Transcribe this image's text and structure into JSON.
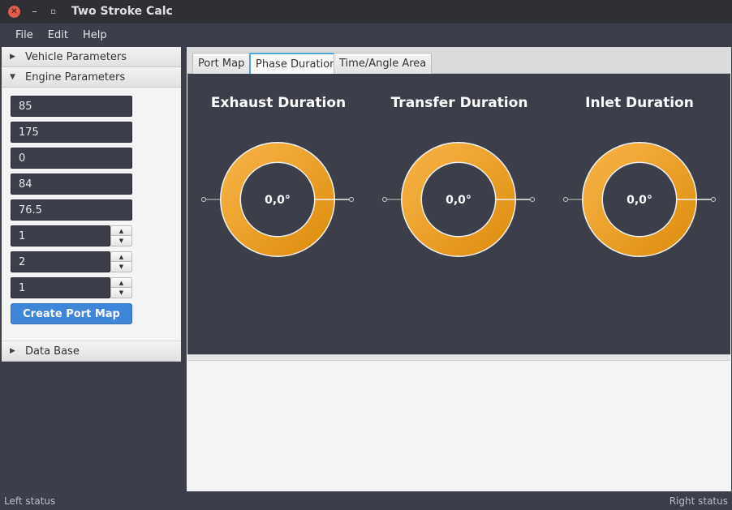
{
  "window": {
    "title": "Two Stroke Calc",
    "close_glyph": "✕",
    "minimize_glyph": "–",
    "maximize_glyph": "▫"
  },
  "menu": [
    "File",
    "Edit",
    "Help"
  ],
  "sidebar": {
    "sections": [
      {
        "label": "Vehicle Parameters",
        "expanded": false,
        "arrow": "▶"
      },
      {
        "label": "Engine Parameters",
        "expanded": true,
        "arrow": "▼"
      },
      {
        "label": "Data Base",
        "expanded": false,
        "arrow": "▶"
      }
    ],
    "fields": [
      "85",
      "175",
      "0",
      "84",
      "76.5"
    ],
    "spinners": [
      "1",
      "2",
      "1"
    ],
    "spin_up_glyph": "▲",
    "spin_down_glyph": "▼",
    "create_button": "Create Port Map"
  },
  "tabs": [
    "Port Map",
    "Phase Duration",
    "Time/Angle Area"
  ],
  "active_tab": "Phase Duration",
  "dials": [
    {
      "title": "Exhaust Duration",
      "value": "0,0°"
    },
    {
      "title": "Transfer Duration",
      "value": "0,0°"
    },
    {
      "title": "Inlet Duration",
      "value": "0,0°"
    }
  ],
  "colors": {
    "accent": "#3f86d8",
    "ring_outer": "#f2a83a",
    "ring_inner": "#e0900f",
    "panel_dark": "#3c3f49"
  },
  "status": {
    "left": "Left status",
    "right": "Right status"
  }
}
